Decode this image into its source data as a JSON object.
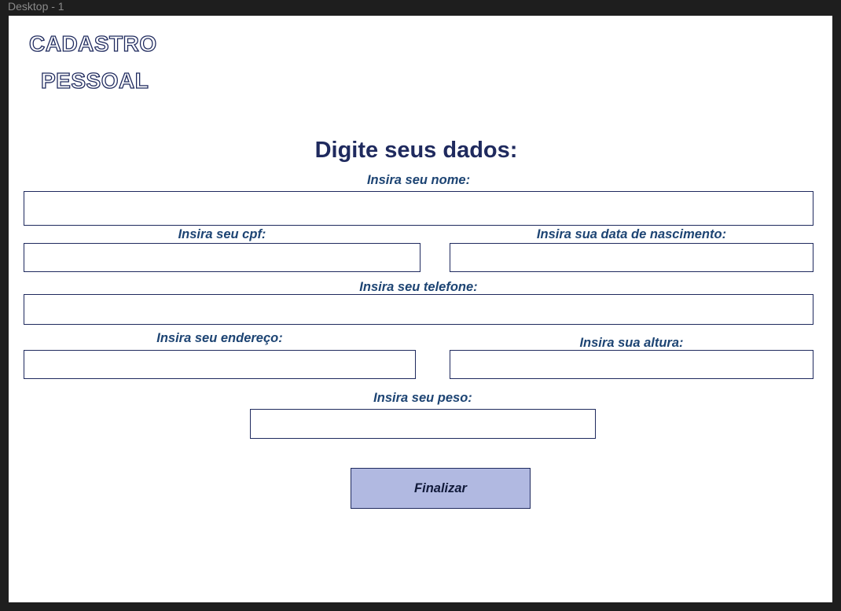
{
  "window": {
    "frame_label": "Desktop - 1"
  },
  "logo": {
    "line1": "CADASTRO",
    "line2": "PESSOAL"
  },
  "form": {
    "title": "Digite seus dados:",
    "fields": {
      "nome": {
        "label": "Insira seu nome:",
        "value": ""
      },
      "cpf": {
        "label": "Insira seu cpf:",
        "value": ""
      },
      "data_nascimento": {
        "label": "Insira sua data de nascimento:",
        "value": ""
      },
      "telefone": {
        "label": "Insira seu telefone:",
        "value": ""
      },
      "endereco": {
        "label": "Insira seu endereço:",
        "value": ""
      },
      "altura": {
        "label": "Insira sua altura:",
        "value": ""
      },
      "peso": {
        "label": "Insira seu peso:",
        "value": ""
      }
    },
    "submit_label": "Finalizar"
  },
  "colors": {
    "canvas_background": "#1e1e1e",
    "artboard": "#ffffff",
    "heading": "#1f2a5e",
    "label": "#1d4473",
    "button_fill": "#b1b9e1",
    "border": "#1f2a5e"
  }
}
